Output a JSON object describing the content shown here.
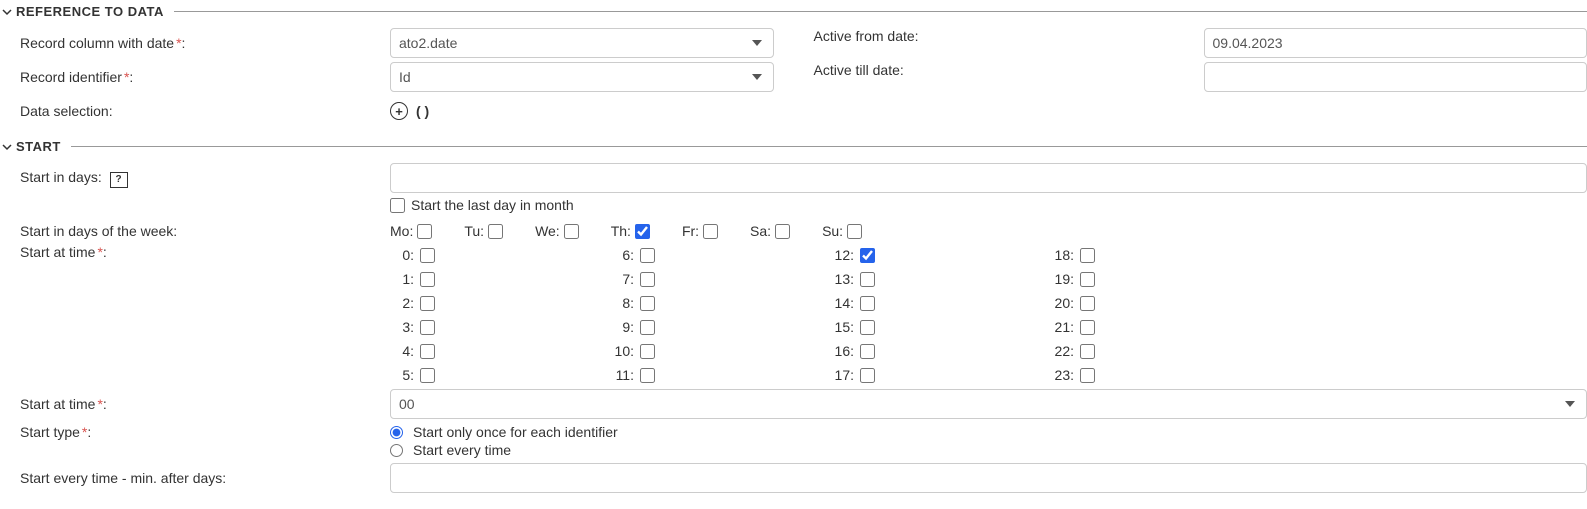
{
  "sections": {
    "reference": {
      "title": "REFERENCE TO DATA",
      "record_column_label": "Record column with date",
      "record_column_value": "ato2.date",
      "record_identifier_label": "Record identifier",
      "record_identifier_value": "Id",
      "data_selection_label": "Data selection:",
      "data_selection_value": "( )",
      "active_from_label": "Active from date:",
      "active_from_value": "09.04.2023",
      "active_till_label": "Active till date:",
      "active_till_value": ""
    },
    "start": {
      "title": "START",
      "start_in_days_label": "Start in days:",
      "start_in_days_value": "",
      "last_day_checkbox_label": "Start the last day in month",
      "last_day_checked": false,
      "start_weekdays_label": "Start in days of the week:",
      "weekdays": [
        {
          "label": "Mo:",
          "checked": false
        },
        {
          "label": "Tu:",
          "checked": false
        },
        {
          "label": "We:",
          "checked": false
        },
        {
          "label": "Th:",
          "checked": true
        },
        {
          "label": "Fr:",
          "checked": false
        },
        {
          "label": "Sa:",
          "checked": false
        },
        {
          "label": "Su:",
          "checked": false
        }
      ],
      "start_at_time_label": "Start at time",
      "hours": [
        {
          "label": "0:",
          "checked": false
        },
        {
          "label": "1:",
          "checked": false
        },
        {
          "label": "2:",
          "checked": false
        },
        {
          "label": "3:",
          "checked": false
        },
        {
          "label": "4:",
          "checked": false
        },
        {
          "label": "5:",
          "checked": false
        },
        {
          "label": "6:",
          "checked": false
        },
        {
          "label": "7:",
          "checked": false
        },
        {
          "label": "8:",
          "checked": false
        },
        {
          "label": "9:",
          "checked": false
        },
        {
          "label": "10:",
          "checked": false
        },
        {
          "label": "11:",
          "checked": false
        },
        {
          "label": "12:",
          "checked": true
        },
        {
          "label": "13:",
          "checked": false
        },
        {
          "label": "14:",
          "checked": false
        },
        {
          "label": "15:",
          "checked": false
        },
        {
          "label": "16:",
          "checked": false
        },
        {
          "label": "17:",
          "checked": false
        },
        {
          "label": "18:",
          "checked": false
        },
        {
          "label": "19:",
          "checked": false
        },
        {
          "label": "20:",
          "checked": false
        },
        {
          "label": "21:",
          "checked": false
        },
        {
          "label": "22:",
          "checked": false
        },
        {
          "label": "23:",
          "checked": false
        }
      ],
      "start_at_time_select_label": "Start at time",
      "start_at_time_select_value": "00",
      "start_type_label": "Start type",
      "start_type_options": [
        {
          "label": "Start only once for each identifier",
          "checked": true
        },
        {
          "label": "Start every time",
          "checked": false
        }
      ],
      "start_every_time_label": "Start every time - min. after days:",
      "start_every_time_value": ""
    }
  }
}
